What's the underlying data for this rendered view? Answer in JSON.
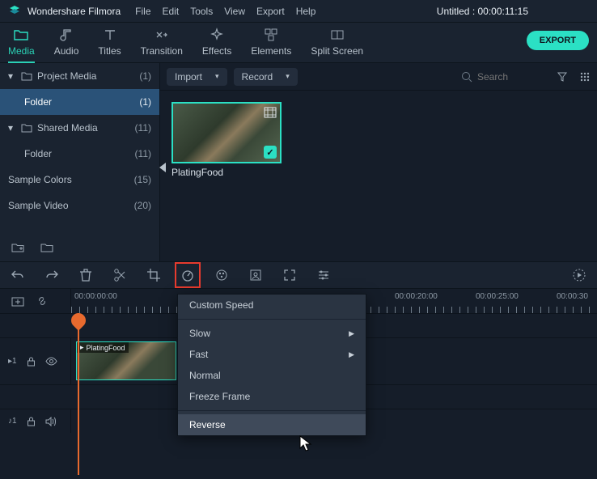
{
  "titlebar": {
    "app_name": "Wondershare Filmora",
    "menus": [
      "File",
      "Edit",
      "Tools",
      "View",
      "Export",
      "Help"
    ],
    "project_title": "Untitled : 00:00:11:15"
  },
  "toolbar": {
    "tabs": [
      {
        "label": "Media",
        "icon": "folder-icon"
      },
      {
        "label": "Audio",
        "icon": "music-icon"
      },
      {
        "label": "Titles",
        "icon": "text-icon"
      },
      {
        "label": "Transition",
        "icon": "transition-icon"
      },
      {
        "label": "Effects",
        "icon": "sparkle-icon"
      },
      {
        "label": "Elements",
        "icon": "elements-icon"
      },
      {
        "label": "Split Screen",
        "icon": "splitscreen-icon"
      }
    ],
    "export_label": "EXPORT"
  },
  "sidebar": {
    "items": [
      {
        "label": "Project Media",
        "count": "(1)",
        "indent": 0,
        "folder": true,
        "chev": "▾"
      },
      {
        "label": "Folder",
        "count": "(1)",
        "indent": 1,
        "folder": false,
        "selected": true
      },
      {
        "label": "Shared Media",
        "count": "(11)",
        "indent": 0,
        "folder": true,
        "chev": "▾"
      },
      {
        "label": "Folder",
        "count": "(11)",
        "indent": 1,
        "folder": false
      },
      {
        "label": "Sample Colors",
        "count": "(15)",
        "indent": 0,
        "folder": false,
        "nochev": true
      },
      {
        "label": "Sample Video",
        "count": "(20)",
        "indent": 0,
        "folder": false,
        "nochev": true
      }
    ]
  },
  "panel": {
    "import_label": "Import",
    "record_label": "Record",
    "search_placeholder": "Search",
    "clip_name": "PlatingFood"
  },
  "context_menu": {
    "items": [
      {
        "label": "Custom Speed",
        "submenu": false
      },
      {
        "sep": true
      },
      {
        "label": "Slow",
        "submenu": true
      },
      {
        "label": "Fast",
        "submenu": true
      },
      {
        "label": "Normal",
        "submenu": false
      },
      {
        "label": "Freeze Frame",
        "submenu": false
      },
      {
        "sep": true
      },
      {
        "label": "Reverse",
        "submenu": false,
        "hovered": true
      }
    ]
  },
  "ruler": {
    "ticks": [
      "00:00:00:00",
      "",
      "",
      "",
      "00:00:20:00",
      "00:00:25:00",
      "00:00:30"
    ]
  },
  "tracks": {
    "video_label": "▸1",
    "audio_label": "♪1",
    "clip_name": "PlatingFood"
  }
}
